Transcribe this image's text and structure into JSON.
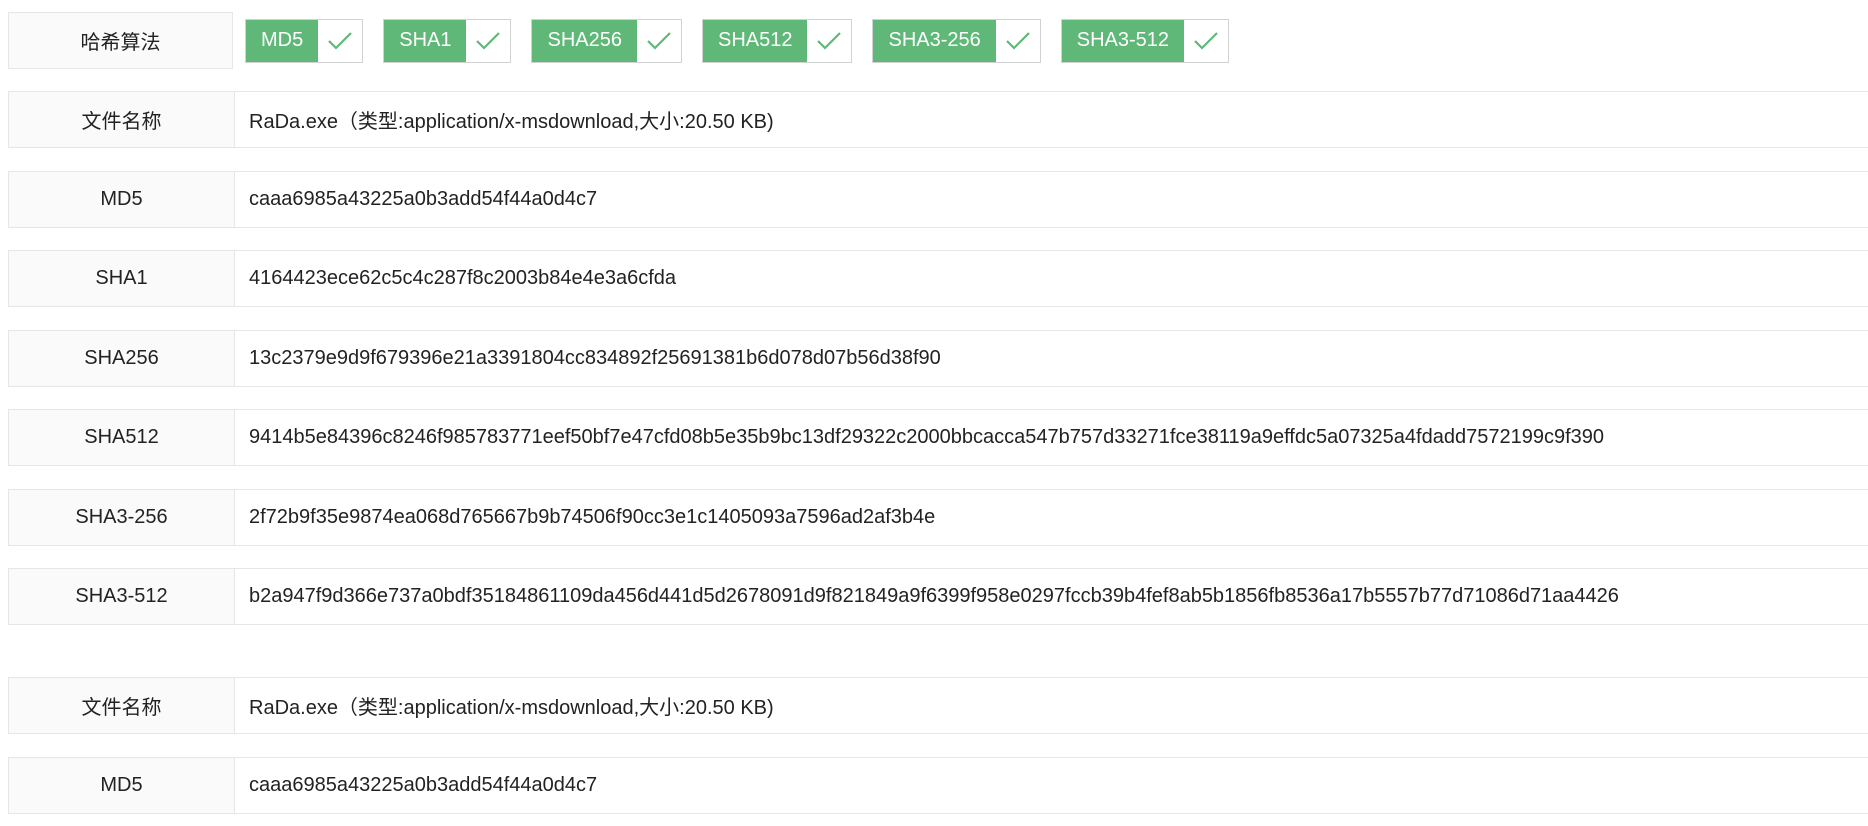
{
  "algorithms": {
    "label": "哈希算法",
    "options": [
      {
        "name": "MD5",
        "checked": true
      },
      {
        "name": "SHA1",
        "checked": true
      },
      {
        "name": "SHA256",
        "checked": true
      },
      {
        "name": "SHA512",
        "checked": true
      },
      {
        "name": "SHA3-256",
        "checked": true
      },
      {
        "name": "SHA3-512",
        "checked": true
      }
    ],
    "check_color": "#5fb878"
  },
  "results": [
    {
      "file_name_label": "文件名称",
      "file_name_value": "RaDa.exe（类型:application/x-msdownload,大小:20.50 KB)",
      "hashes": [
        {
          "label": "MD5",
          "value": "caaa6985a43225a0b3add54f44a0d4c7"
        },
        {
          "label": "SHA1",
          "value": "4164423ece62c5c4c287f8c2003b84e4e3a6cfda"
        },
        {
          "label": "SHA256",
          "value": "13c2379e9d9f679396e21a3391804cc834892f25691381b6d078d07b56d38f90"
        },
        {
          "label": "SHA512",
          "value": "9414b5e84396c8246f985783771eef50bf7e47cfd08b5e35b9bc13df29322c2000bbcacca547b757d33271fce38119a9effdc5a07325a4fdadd7572199c9f390"
        },
        {
          "label": "SHA3-256",
          "value": "2f72b9f35e9874ea068d765667b9b74506f90cc3e1c1405093a7596ad2af3b4e"
        },
        {
          "label": "SHA3-512",
          "value": "b2a947f9d366e737a0bdf35184861109da456d441d5d2678091d9f821849a9f6399f958e0297fccb39b4fef8ab5b1856fb8536a17b5557b77d71086d71aa4426"
        }
      ]
    },
    {
      "file_name_label": "文件名称",
      "file_name_value": "RaDa.exe（类型:application/x-msdownload,大小:20.50 KB)",
      "hashes": [
        {
          "label": "MD5",
          "value": "caaa6985a43225a0b3add54f44a0d4c7"
        }
      ]
    }
  ]
}
